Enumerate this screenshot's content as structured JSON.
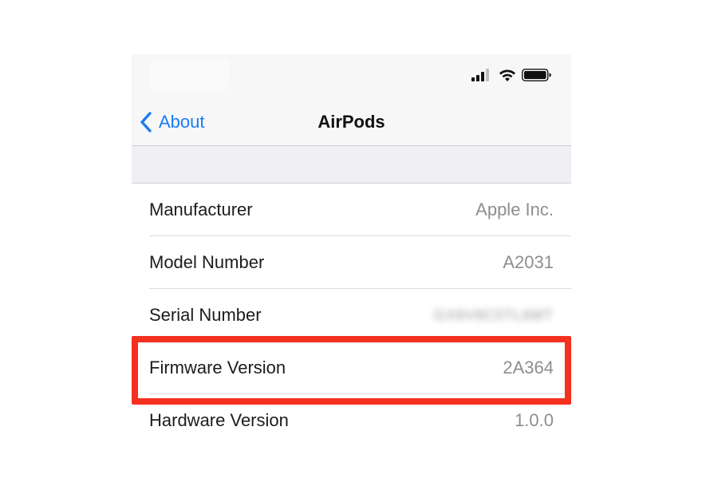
{
  "status_bar": {
    "icons": [
      "signal-icon",
      "wifi-icon",
      "battery-icon"
    ]
  },
  "navbar": {
    "back_label": "About",
    "title": "AirPods"
  },
  "rows": [
    {
      "label": "Manufacturer",
      "value": "Apple Inc."
    },
    {
      "label": "Model Number",
      "value": "A2031"
    },
    {
      "label": "Serial Number",
      "value": "GX8V8C0TL6MT"
    },
    {
      "label": "Firmware Version",
      "value": "2A364"
    },
    {
      "label": "Hardware Version",
      "value": "1.0.0"
    }
  ],
  "highlight": {
    "target_row": "Firmware Version",
    "color": "#f4311f"
  },
  "colors": {
    "accent": "#1a7cf5",
    "value_text": "#8e8e93"
  }
}
